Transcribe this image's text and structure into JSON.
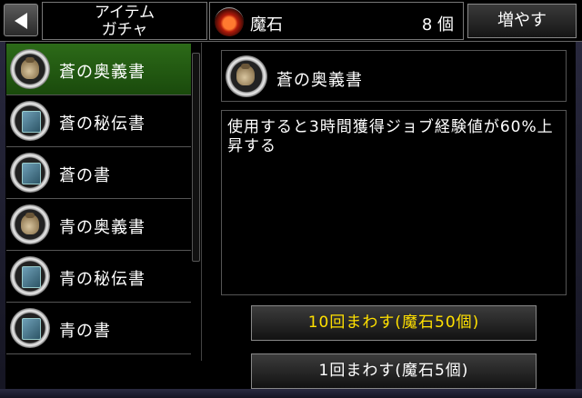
{
  "header": {
    "back_icon": "back-arrow-icon",
    "title": "アイテム\nガチャ",
    "currency": {
      "icon": "magic-stone-icon",
      "name": "魔石",
      "count": "8 個"
    },
    "increase_label": "増やす"
  },
  "item_list": [
    {
      "label": "蒼の奥義書",
      "icon": "bag-icon",
      "selected": true
    },
    {
      "label": "蒼の秘伝書",
      "icon": "book-icon",
      "selected": false
    },
    {
      "label": "蒼の書",
      "icon": "book-icon",
      "selected": false
    },
    {
      "label": "青の奥義書",
      "icon": "bag-icon",
      "selected": false
    },
    {
      "label": "青の秘伝書",
      "icon": "book-icon",
      "selected": false
    },
    {
      "label": "青の書",
      "icon": "book-icon",
      "selected": false
    }
  ],
  "detail": {
    "icon": "bag-icon",
    "name": "蒼の奥義書",
    "description": "使用すると3時間獲得ジョブ経験値が60%上昇する"
  },
  "buttons": {
    "gacha_10": "10回まわす(魔石50個)",
    "gacha_1": "1回まわす(魔石5個)"
  },
  "colors": {
    "selected_bg": "#2c6a18",
    "gacha_10_text": "#ffe000"
  }
}
